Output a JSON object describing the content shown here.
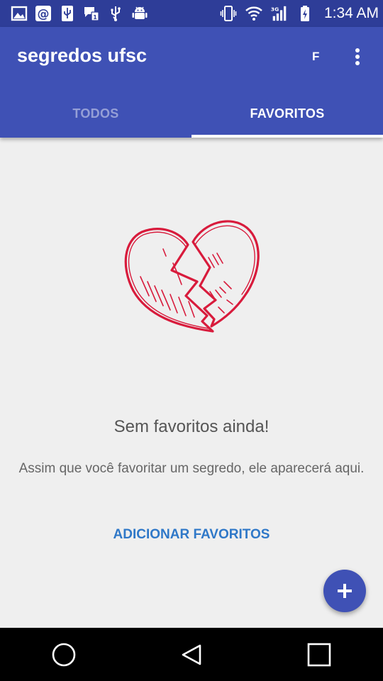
{
  "status_bar": {
    "time": "1:34 AM",
    "network_type": "3G",
    "left_icons": [
      "image-icon",
      "at-sign-icon",
      "usb-icon",
      "sms-icon",
      "usb-debug-icon",
      "android-icon"
    ],
    "right_icons": [
      "vibrate-icon",
      "wifi-icon",
      "signal-icon",
      "battery-charging-icon"
    ]
  },
  "app_bar": {
    "title": "segredos ufsc",
    "user_initial": "F",
    "overflow_icon": "more-vertical-icon",
    "color": "#3f51b5"
  },
  "tabs": [
    {
      "label": "TODOS",
      "active": false
    },
    {
      "label": "FAVORITOS",
      "active": true
    }
  ],
  "empty_state": {
    "illustration": "broken-heart-icon",
    "illustration_color": "#d81b3c",
    "title": "Sem favoritos ainda!",
    "subtitle": "Assim que você favoritar um segredo, ele aparecerá aqui.",
    "action_label": "ADICIONAR FAVORITOS",
    "action_color": "#2f78c8"
  },
  "fab": {
    "icon": "plus-icon",
    "color": "#3f51b5"
  },
  "nav_bar": {
    "icons": [
      "home-circle-icon",
      "back-triangle-icon",
      "recents-square-icon"
    ]
  }
}
